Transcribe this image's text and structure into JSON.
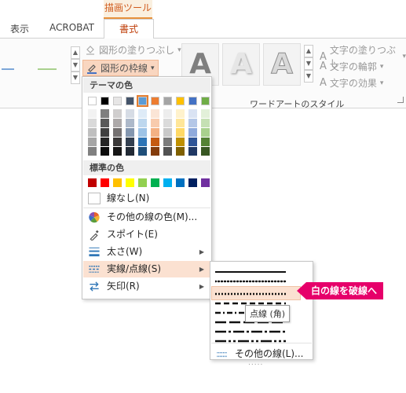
{
  "ribbon": {
    "context_tab": "描画ツール",
    "tabs": [
      "表示",
      "ACROBAT"
    ],
    "active_tab": "書式",
    "shape_fill": "図形の塗りつぶし",
    "shape_outline": "図形の枠線",
    "dropdown_glyph": "▾",
    "text_fill": "文字の塗りつぶし",
    "text_outline": "文字の輪郭",
    "text_effects": "文字の効果",
    "wordart_letter": "A",
    "wordart_group": "ワードアートのスタイル"
  },
  "menu": {
    "theme_colors_header": "テーマの色",
    "standard_colors_header": "標準の色",
    "theme_top_row": [
      "#ffffff",
      "#000000",
      "#e7e6e6",
      "#44546a",
      "#5b9bd5",
      "#ed7d31",
      "#a5a5a5",
      "#ffc000",
      "#4472c4",
      "#70ad47"
    ],
    "theme_shades": [
      [
        "#f2f2f2",
        "#d9d9d9",
        "#bfbfbf",
        "#a6a6a6",
        "#808080"
      ],
      [
        "#7f7f7f",
        "#595959",
        "#404040",
        "#262626",
        "#0d0d0d"
      ],
      [
        "#d0cece",
        "#aeaaaa",
        "#757171",
        "#3a3838",
        "#171616"
      ],
      [
        "#d6dce5",
        "#adb9ca",
        "#8497b0",
        "#333f50",
        "#222a35"
      ],
      [
        "#deebf7",
        "#bdd7ee",
        "#9dc3e6",
        "#2e75b6",
        "#1f4e79"
      ],
      [
        "#fbe5d6",
        "#f8cbad",
        "#f4b183",
        "#c55a11",
        "#843c0c"
      ],
      [
        "#ededed",
        "#dbdbdb",
        "#c9c9c9",
        "#7b7b7b",
        "#525252"
      ],
      [
        "#fff2cc",
        "#ffe699",
        "#ffd966",
        "#bf9000",
        "#7f6000"
      ],
      [
        "#dae3f3",
        "#b4c7e7",
        "#8faadc",
        "#2f5597",
        "#203864"
      ],
      [
        "#e2f0d9",
        "#c5e0b4",
        "#a9d18e",
        "#548235",
        "#385723"
      ]
    ],
    "selected_theme_index": 4,
    "standard_colors": [
      "#c00000",
      "#ff0000",
      "#ffc000",
      "#ffff00",
      "#92d050",
      "#00b050",
      "#00b0f0",
      "#0070c0",
      "#002060",
      "#7030a0"
    ],
    "no_line": "線なし(N)",
    "more_colors": "その他の線の色(M)...",
    "eyedropper": "スポイト(E)",
    "weight": "太さ(W)",
    "dashes": "実線/点線(S)",
    "arrows": "矢印(R)",
    "submenu_arrow": "▶"
  },
  "submenu": {
    "styles": [
      "solid",
      "round-dot",
      "square-dot",
      "dash",
      "dash-dot",
      "long-dash",
      "long-dash-dot",
      "long-dash-dot-dot"
    ],
    "highlighted_index": 2,
    "more_lines": "その他の線(L)...",
    "tooltip": "点線 (角)",
    "grip": "....."
  },
  "annotation": {
    "callout_text": "白の線を破線へ",
    "callout_color": "#e6006a"
  },
  "colors": {
    "accent_orange": "#e47e30",
    "highlight_bg": "#fbe1d1"
  }
}
